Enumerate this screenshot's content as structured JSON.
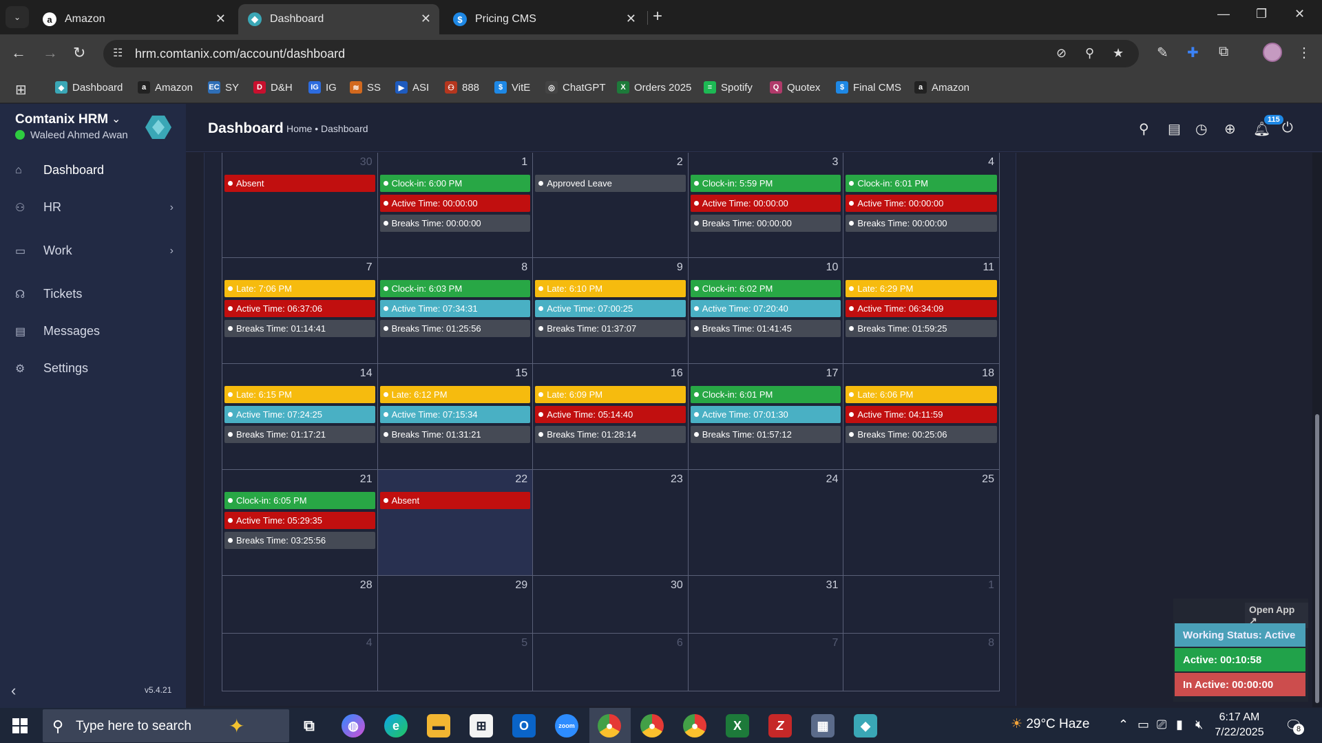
{
  "browser": {
    "tabs": [
      {
        "title": "Amazon",
        "icon": "amazon-icon",
        "active": false
      },
      {
        "title": "Dashboard",
        "icon": "comtanix-icon",
        "active": true
      },
      {
        "title": "Pricing CMS",
        "icon": "dollar-icon",
        "active": false
      }
    ],
    "url": "hrm.comtanix.com/account/dashboard",
    "bookmarks": [
      {
        "label": "Dashboard",
        "color": "#3aa7b6",
        "glyph": "◆"
      },
      {
        "label": "Amazon",
        "color": "#222",
        "glyph": "a"
      },
      {
        "label": "SY",
        "color": "#2f6fb7",
        "glyph": "EC"
      },
      {
        "label": "D&H",
        "color": "#c8102e",
        "glyph": "D"
      },
      {
        "label": "IG",
        "color": "#2d6cdf",
        "glyph": "IG"
      },
      {
        "label": "SS",
        "color": "#d2691e",
        "glyph": "≋"
      },
      {
        "label": "ASI",
        "color": "#1e5bbf",
        "glyph": "▶"
      },
      {
        "label": "888",
        "color": "#b5361e",
        "glyph": "⚇"
      },
      {
        "label": "VitE",
        "color": "#1e88e5",
        "glyph": "$"
      },
      {
        "label": "ChatGPT",
        "color": "#444",
        "glyph": "◎"
      },
      {
        "label": "Orders 2025",
        "color": "#1d7a3a",
        "glyph": "X"
      },
      {
        "label": "Spotify",
        "color": "#1db954",
        "glyph": "≡"
      },
      {
        "label": "Quotex",
        "color": "#b03a6a",
        "glyph": "Q"
      },
      {
        "label": "Final CMS",
        "color": "#1e88e5",
        "glyph": "$"
      },
      {
        "label": "Amazon",
        "color": "#222",
        "glyph": "a"
      }
    ]
  },
  "app": {
    "brand": "Comtanix HRM",
    "user": "Waleed Ahmed Awan",
    "version": "v5.4.21",
    "nav": [
      {
        "label": "Dashboard",
        "icon": "home-icon",
        "active": true,
        "has_children": false
      },
      {
        "label": "HR",
        "icon": "users-icon",
        "active": false,
        "has_children": true
      },
      {
        "label": "Work",
        "icon": "briefcase-icon",
        "active": false,
        "has_children": true
      },
      {
        "label": "Tickets",
        "icon": "headset-icon",
        "active": false,
        "has_children": false
      },
      {
        "label": "Messages",
        "icon": "message-icon",
        "active": false,
        "has_children": false
      },
      {
        "label": "Settings",
        "icon": "gear-icon",
        "active": false,
        "has_children": false
      }
    ],
    "page_title": "Dashboard",
    "breadcrumb": "Home • Dashboard",
    "notification_count": "115"
  },
  "calendar": {
    "weeks": [
      [
        {
          "day": "30",
          "other": true,
          "events": [
            {
              "text": "Absent",
              "type": "red"
            }
          ]
        },
        {
          "day": "1",
          "events": [
            {
              "text": "Clock-in: 6:00 PM",
              "type": "green"
            },
            {
              "text": "Active Time: 00:00:00",
              "type": "red"
            },
            {
              "text": "Breaks Time: 00:00:00",
              "type": "gray"
            }
          ]
        },
        {
          "day": "2",
          "events": [
            {
              "text": "Approved Leave",
              "type": "gray"
            }
          ]
        },
        {
          "day": "3",
          "events": [
            {
              "text": "Clock-in: 5:59 PM",
              "type": "green"
            },
            {
              "text": "Active Time: 00:00:00",
              "type": "red"
            },
            {
              "text": "Breaks Time: 00:00:00",
              "type": "gray"
            }
          ]
        },
        {
          "day": "4",
          "events": [
            {
              "text": "Clock-in: 6:01 PM",
              "type": "green"
            },
            {
              "text": "Active Time: 00:00:00",
              "type": "red"
            },
            {
              "text": "Breaks Time: 00:00:00",
              "type": "gray"
            }
          ]
        }
      ],
      [
        {
          "day": "7",
          "events": [
            {
              "text": "Late: 7:06 PM",
              "type": "yellow"
            },
            {
              "text": "Active Time: 06:37:06",
              "type": "red"
            },
            {
              "text": "Breaks Time: 01:14:41",
              "type": "gray"
            }
          ]
        },
        {
          "day": "8",
          "events": [
            {
              "text": "Clock-in: 6:03 PM",
              "type": "green"
            },
            {
              "text": "Active Time: 07:34:31",
              "type": "cyan"
            },
            {
              "text": "Breaks Time: 01:25:56",
              "type": "gray"
            }
          ]
        },
        {
          "day": "9",
          "events": [
            {
              "text": "Late: 6:10 PM",
              "type": "yellow"
            },
            {
              "text": "Active Time: 07:00:25",
              "type": "cyan"
            },
            {
              "text": "Breaks Time: 01:37:07",
              "type": "gray"
            }
          ]
        },
        {
          "day": "10",
          "events": [
            {
              "text": "Clock-in: 6:02 PM",
              "type": "green"
            },
            {
              "text": "Active Time: 07:20:40",
              "type": "cyan"
            },
            {
              "text": "Breaks Time: 01:41:45",
              "type": "gray"
            }
          ]
        },
        {
          "day": "11",
          "events": [
            {
              "text": "Late: 6:29 PM",
              "type": "yellow"
            },
            {
              "text": "Active Time: 06:34:09",
              "type": "red"
            },
            {
              "text": "Breaks Time: 01:59:25",
              "type": "gray"
            }
          ]
        }
      ],
      [
        {
          "day": "14",
          "events": [
            {
              "text": "Late: 6:15 PM",
              "type": "yellow"
            },
            {
              "text": "Active Time: 07:24:25",
              "type": "cyan"
            },
            {
              "text": "Breaks Time: 01:17:21",
              "type": "gray"
            }
          ]
        },
        {
          "day": "15",
          "events": [
            {
              "text": "Late: 6:12 PM",
              "type": "yellow"
            },
            {
              "text": "Active Time: 07:15:34",
              "type": "cyan"
            },
            {
              "text": "Breaks Time: 01:31:21",
              "type": "gray"
            }
          ]
        },
        {
          "day": "16",
          "events": [
            {
              "text": "Late: 6:09 PM",
              "type": "yellow"
            },
            {
              "text": "Active Time: 05:14:40",
              "type": "red"
            },
            {
              "text": "Breaks Time: 01:28:14",
              "type": "gray"
            }
          ]
        },
        {
          "day": "17",
          "events": [
            {
              "text": "Clock-in: 6:01 PM",
              "type": "green"
            },
            {
              "text": "Active Time: 07:01:30",
              "type": "cyan"
            },
            {
              "text": "Breaks Time: 01:57:12",
              "type": "gray"
            }
          ]
        },
        {
          "day": "18",
          "events": [
            {
              "text": "Late: 6:06 PM",
              "type": "yellow"
            },
            {
              "text": "Active Time: 04:11:59",
              "type": "red"
            },
            {
              "text": "Breaks Time: 00:25:06",
              "type": "gray"
            }
          ]
        }
      ],
      [
        {
          "day": "21",
          "events": [
            {
              "text": "Clock-in: 6:05 PM",
              "type": "green"
            },
            {
              "text": "Active Time: 05:29:35",
              "type": "red"
            },
            {
              "text": "Breaks Time: 03:25:56",
              "type": "gray"
            }
          ]
        },
        {
          "day": "22",
          "today": true,
          "events": [
            {
              "text": "Absent",
              "type": "red"
            }
          ]
        },
        {
          "day": "23",
          "events": []
        },
        {
          "day": "24",
          "events": []
        },
        {
          "day": "25",
          "events": []
        }
      ],
      [
        {
          "day": "28",
          "events": []
        },
        {
          "day": "29",
          "events": []
        },
        {
          "day": "30",
          "events": []
        },
        {
          "day": "31",
          "events": []
        },
        {
          "day": "1",
          "other": true,
          "events": []
        }
      ],
      [
        {
          "day": "4",
          "other": true,
          "events": []
        },
        {
          "day": "5",
          "other": true,
          "events": []
        },
        {
          "day": "6",
          "other": true,
          "events": []
        },
        {
          "day": "7",
          "other": true,
          "events": []
        },
        {
          "day": "8",
          "other": true,
          "events": []
        }
      ]
    ]
  },
  "widget": {
    "open_app": "Open App ↗",
    "working_status": "Working Status: Active",
    "active": "Active: 00:10:58",
    "inactive": "In Active: 00:00:00"
  },
  "taskbar": {
    "search_placeholder": "Type here to search",
    "weather": "29°C  Haze",
    "time": "6:17 AM",
    "date": "7/22/2025",
    "notification_count": "8"
  }
}
